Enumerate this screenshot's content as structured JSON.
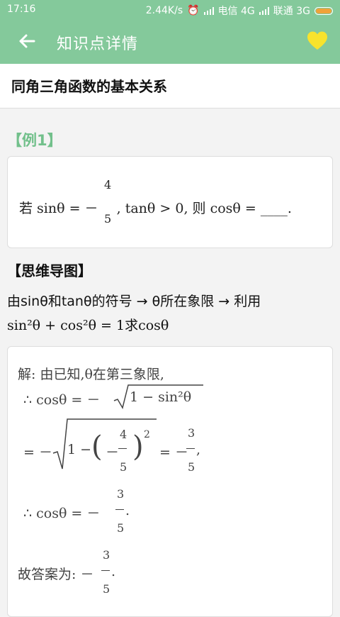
{
  "status": {
    "time": "17:16",
    "speed": "2.44K/s",
    "carrier1": "电信 4G",
    "carrier2": "联通 3G"
  },
  "appbar": {
    "title": "知识点详情",
    "back_icon": "arrow-left-icon",
    "favorite_icon": "heart-icon",
    "accent": "#84c99b",
    "heart_color": "#f7e32d"
  },
  "topic": {
    "title": "同角三角函数的基本关系"
  },
  "example": {
    "tag": "【例1】",
    "question_prefix": "若 sinθ = －",
    "frac_num": "4",
    "frac_den": "5",
    "question_suffix": ", tanθ > 0, 则 cosθ = ____."
  },
  "mindmap": {
    "title": "【思维导图】",
    "line1": "由sinθ和tanθ的符号 → θ所在象限 → 利用",
    "line2": "sin²θ + cos²θ = 1求cosθ"
  },
  "solution": {
    "l1": "解: 由已知,θ在第三象限,",
    "l2_prefix": "∴  cosθ = －",
    "l2_root": "1 − sin²θ",
    "l3_eq": "= －",
    "l3_inner": "1 − ",
    "l3_neg": "－",
    "l3_num": "4",
    "l3_den": "5",
    "l3_exp": "2",
    "l3_res": "= －",
    "l3_rnum": "3",
    "l3_rden": "5",
    "l3_comma": ",",
    "l4_prefix": "∴  cosθ = －",
    "l4_num": "3",
    "l4_den": "5",
    "l4_dot": ".",
    "l5_prefix": "故答案为: －",
    "l5_num": "3",
    "l5_den": "5",
    "l5_dot": "."
  }
}
